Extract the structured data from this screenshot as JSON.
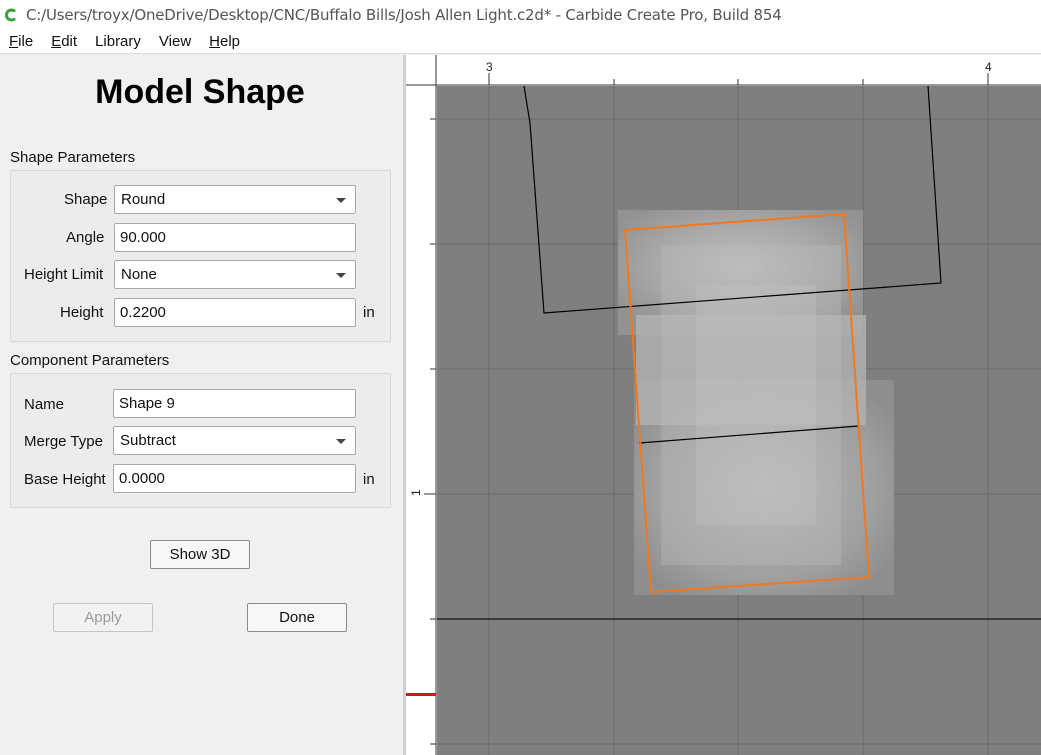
{
  "window": {
    "title": "C:/Users/troyx/OneDrive/Desktop/CNC/Buffalo Bills/Josh Allen Light.c2d* - Carbide Create Pro, Build 854"
  },
  "menu": [
    {
      "label": "File",
      "mnemonic": "F",
      "rest": "ile"
    },
    {
      "label": "Edit",
      "mnemonic": "E",
      "rest": "dit"
    },
    {
      "label": "Library",
      "mnemonic": "",
      "rest": "Library"
    },
    {
      "label": "View",
      "mnemonic": "",
      "rest": "View"
    },
    {
      "label": "Help",
      "mnemonic": "H",
      "rest": "elp"
    }
  ],
  "panel": {
    "title": "Model Shape",
    "shape_params": {
      "heading": "Shape Parameters",
      "shape_label": "Shape",
      "shape_value": "Round",
      "angle_label": "Angle",
      "angle_value": "90.000",
      "height_limit_label": "Height Limit",
      "height_limit_value": "None",
      "height_label": "Height",
      "height_value": "0.2200",
      "height_unit": "in"
    },
    "component_params": {
      "heading": "Component Parameters",
      "name_label": "Name",
      "name_value": "Shape 9",
      "merge_label": "Merge Type",
      "merge_value": "Subtract",
      "base_label": "Base Height",
      "base_value": "0.0000",
      "base_unit": "in"
    },
    "show3d_label": "Show 3D",
    "apply_label": "Apply",
    "done_label": "Done"
  },
  "canvas": {
    "ruler_top_labels": [
      "3",
      "4"
    ],
    "ruler_left_labels": [
      "1"
    ],
    "background_color": "#7f7f7f",
    "selection_color": "#f07820"
  }
}
